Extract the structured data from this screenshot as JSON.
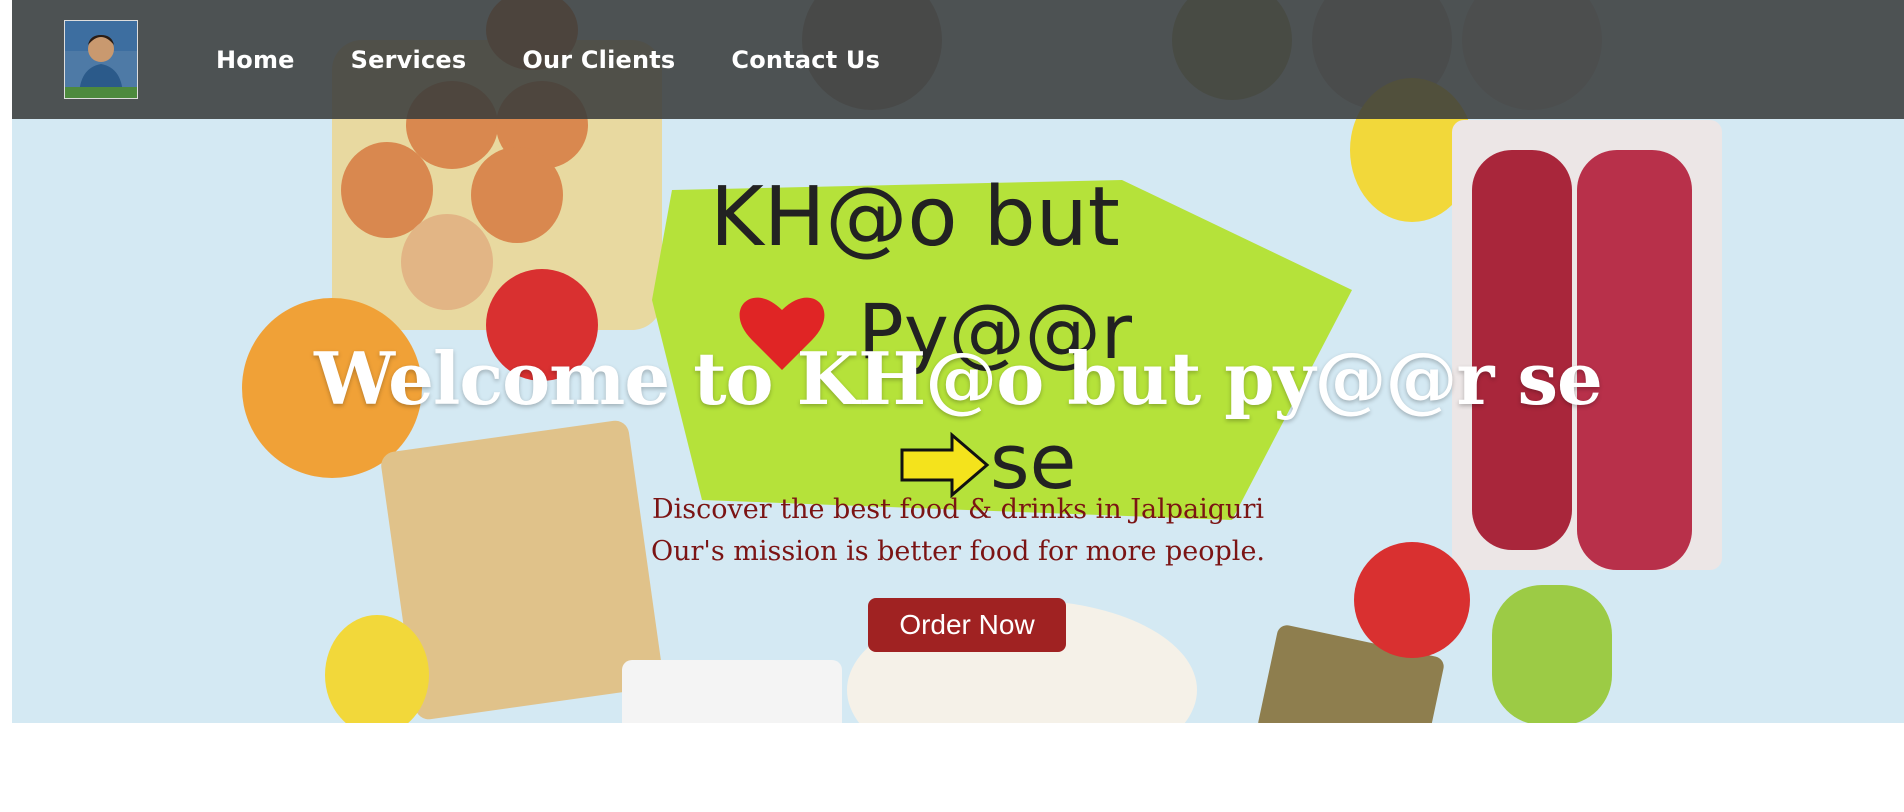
{
  "nav": {
    "logo_alt": "profile photo",
    "links": [
      {
        "label": "Home"
      },
      {
        "label": "Services"
      },
      {
        "label": "Our Clients"
      },
      {
        "label": "Contact Us"
      }
    ]
  },
  "hero": {
    "logo_text_line1": "KH@o but",
    "logo_text_line2": "Py@@r",
    "logo_text_line3": "se",
    "headline": "Welcome to KH@o but py@@r se",
    "tagline": "Discover the best food & drinks in Jalpaiguri",
    "mission": "Our's mission is better food for more people.",
    "cta_label": "Order Now"
  },
  "colors": {
    "nav_bg": "#3a3c3c",
    "accent": "#a02222",
    "tagline_text": "#7b1414",
    "hero_bg": "#d4e9f3",
    "logo_green": "#b5e23a"
  }
}
